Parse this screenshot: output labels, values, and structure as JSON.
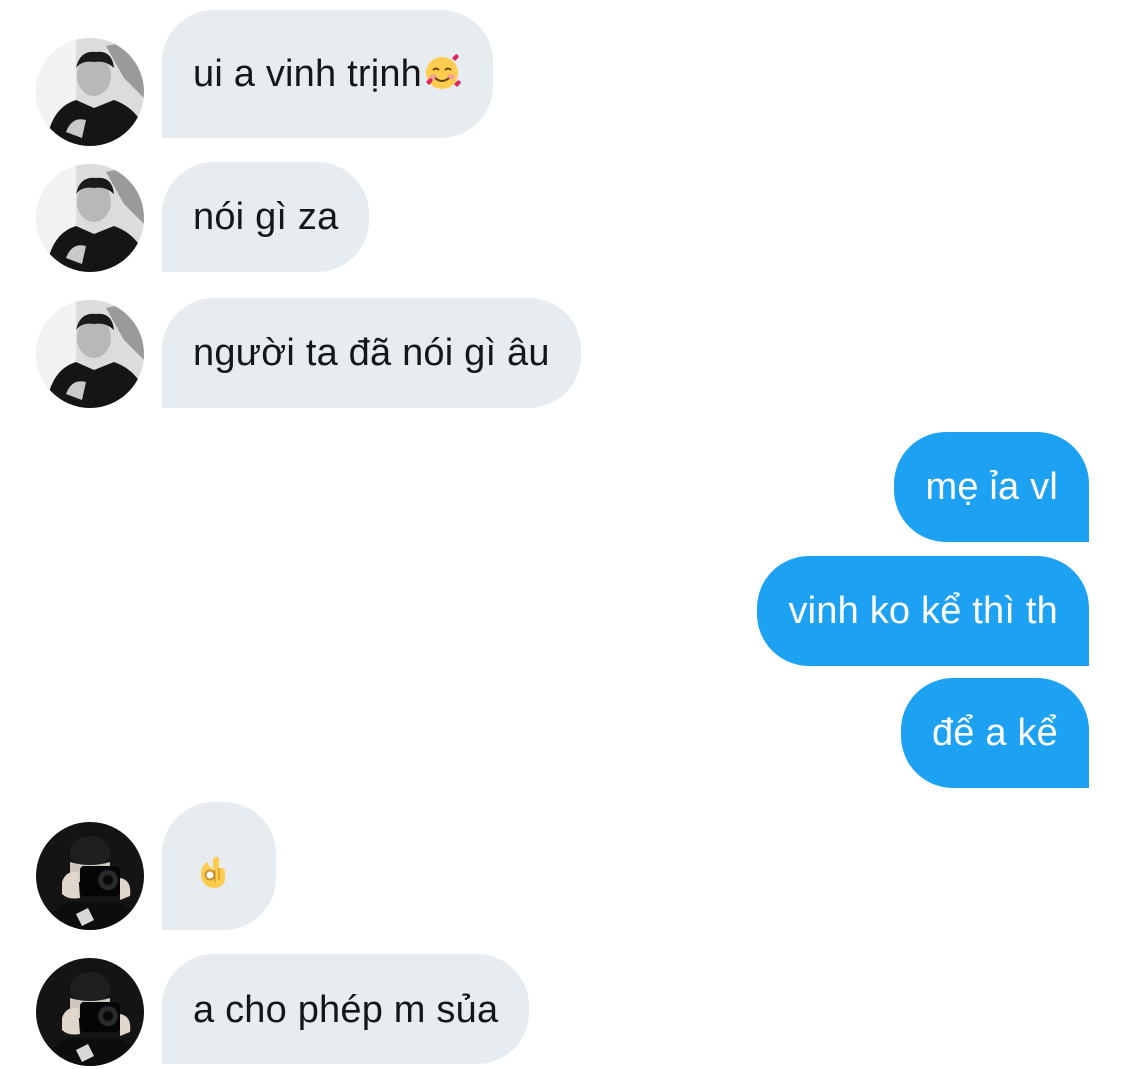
{
  "conversation": {
    "messages": [
      {
        "text": "ui a vinh trịnh",
        "emoji": "smiling-face-with-hearts-icon"
      },
      {
        "text": "nói gì za"
      },
      {
        "text": "người ta đã nói gì âu"
      },
      {
        "text": "mẹ ỉa vl"
      },
      {
        "text": "vinh ko kể thì th"
      },
      {
        "text": "để a kể"
      },
      {
        "text": "",
        "emoji": "ok-hand-icon"
      },
      {
        "text": "a cho phép m sủa"
      }
    ]
  },
  "colors": {
    "incoming_bubble": "#e6ecf0",
    "incoming_text": "#14171a",
    "outgoing_bubble": "#1da1f2",
    "outgoing_text": "#ffffff"
  }
}
